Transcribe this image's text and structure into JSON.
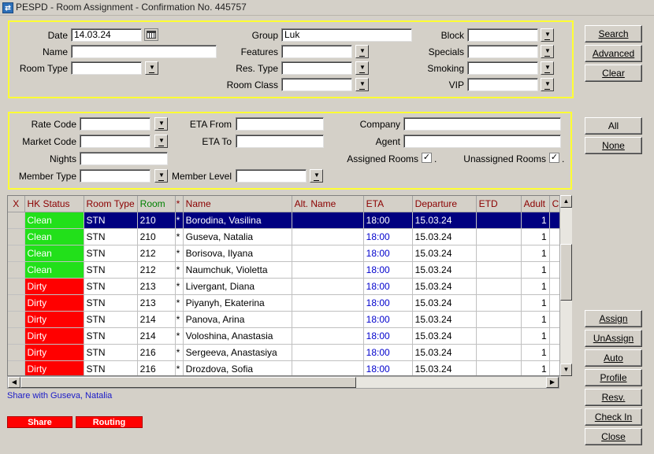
{
  "window": {
    "title": "PESPD - Room Assignment - Confirmation No.  445757"
  },
  "search_panel": {
    "date_label": "Date",
    "date_value": "14.03.24",
    "name_label": "Name",
    "name_value": "",
    "room_type_label": "Room Type",
    "room_type_value": "",
    "group_label": "Group",
    "group_value": "Luk",
    "features_label": "Features",
    "features_value": "",
    "res_type_label": "Res. Type",
    "res_type_value": "",
    "room_class_label": "Room Class",
    "room_class_value": "",
    "block_label": "Block",
    "block_value": "",
    "specials_label": "Specials",
    "specials_value": "",
    "smoking_label": "Smoking",
    "smoking_value": "",
    "vip_label": "VIP",
    "vip_value": ""
  },
  "filter_panel": {
    "rate_code_label": "Rate Code",
    "rate_code_value": "",
    "market_code_label": "Market Code",
    "market_code_value": "",
    "nights_label": "Nights",
    "nights_value": "",
    "member_type_label": "Member Type",
    "member_type_value": "",
    "eta_from_label": "ETA From",
    "eta_from_value": "",
    "eta_to_label": "ETA To",
    "eta_to_value": "",
    "member_level_label": "Member Level",
    "member_level_value": "",
    "company_label": "Company",
    "company_value": "",
    "agent_label": "Agent",
    "agent_value": "",
    "assigned_rooms_label": "Assigned Rooms",
    "assigned_rooms_checked": "✓",
    "unassigned_rooms_label": "Unassigned Rooms",
    "unassigned_rooms_checked": "✓",
    "dot": "."
  },
  "buttons_top": {
    "search": "Search",
    "advanced": "Advanced",
    "clear": "Clear"
  },
  "buttons_mid": {
    "all": "All",
    "none": "None"
  },
  "buttons_bottom": {
    "assign": "Assign",
    "unassign": "UnAssign",
    "auto": "Auto",
    "profile": "Profile",
    "resv": "Resv.",
    "check_in": "Check In",
    "close": "Close"
  },
  "grid": {
    "columns": [
      "X",
      "HK Status",
      "Room Type",
      "Room",
      "*",
      "Name",
      "Alt. Name",
      "ETA",
      "Departure",
      "ETD",
      "Adult",
      "Ch"
    ],
    "rows": [
      {
        "hk": "Clean",
        "type": "STN",
        "room": "210",
        "star": "*",
        "name": "Borodina, Vasilina",
        "alt": "",
        "eta": "18:00",
        "dep": "15.03.24",
        "etd": "",
        "adult": "1"
      },
      {
        "hk": "Clean",
        "type": "STN",
        "room": "210",
        "star": "*",
        "name": "Guseva, Natalia",
        "alt": "",
        "eta": "18:00",
        "dep": "15.03.24",
        "etd": "",
        "adult": "1"
      },
      {
        "hk": "Clean",
        "type": "STN",
        "room": "212",
        "star": "*",
        "name": "Borisova, Ilyana",
        "alt": "",
        "eta": "18:00",
        "dep": "15.03.24",
        "etd": "",
        "adult": "1"
      },
      {
        "hk": "Clean",
        "type": "STN",
        "room": "212",
        "star": "*",
        "name": "Naumchuk, Violetta",
        "alt": "",
        "eta": "18:00",
        "dep": "15.03.24",
        "etd": "",
        "adult": "1"
      },
      {
        "hk": "Dirty",
        "type": "STN",
        "room": "213",
        "star": "*",
        "name": "Livergant, Diana",
        "alt": "",
        "eta": "18:00",
        "dep": "15.03.24",
        "etd": "",
        "adult": "1"
      },
      {
        "hk": "Dirty",
        "type": "STN",
        "room": "213",
        "star": "*",
        "name": "Piyanyh, Ekaterina",
        "alt": "",
        "eta": "18:00",
        "dep": "15.03.24",
        "etd": "",
        "adult": "1"
      },
      {
        "hk": "Dirty",
        "type": "STN",
        "room": "214",
        "star": "*",
        "name": "Panova, Arina",
        "alt": "",
        "eta": "18:00",
        "dep": "15.03.24",
        "etd": "",
        "adult": "1"
      },
      {
        "hk": "Dirty",
        "type": "STN",
        "room": "214",
        "star": "*",
        "name": "Voloshina, Anastasia",
        "alt": "",
        "eta": "18:00",
        "dep": "15.03.24",
        "etd": "",
        "adult": "1"
      },
      {
        "hk": "Dirty",
        "type": "STN",
        "room": "216",
        "star": "*",
        "name": "Sergeeva, Anastasiya",
        "alt": "",
        "eta": "18:00",
        "dep": "15.03.24",
        "etd": "",
        "adult": "1"
      },
      {
        "hk": "Dirty",
        "type": "STN",
        "room": "216",
        "star": "*",
        "name": "Drozdova, Sofia",
        "alt": "",
        "eta": "18:00",
        "dep": "15.03.24",
        "etd": "",
        "adult": "1"
      }
    ]
  },
  "footer": {
    "share_info": "Share with Guseva, Natalia",
    "share_button": "Share",
    "routing_button": "Routing"
  },
  "colors": {
    "clean": "#22e01a",
    "dirty": "#ff0000",
    "selected_row": "#000080",
    "panel_border": "#ffff33",
    "eta_text": "#0000cc"
  }
}
